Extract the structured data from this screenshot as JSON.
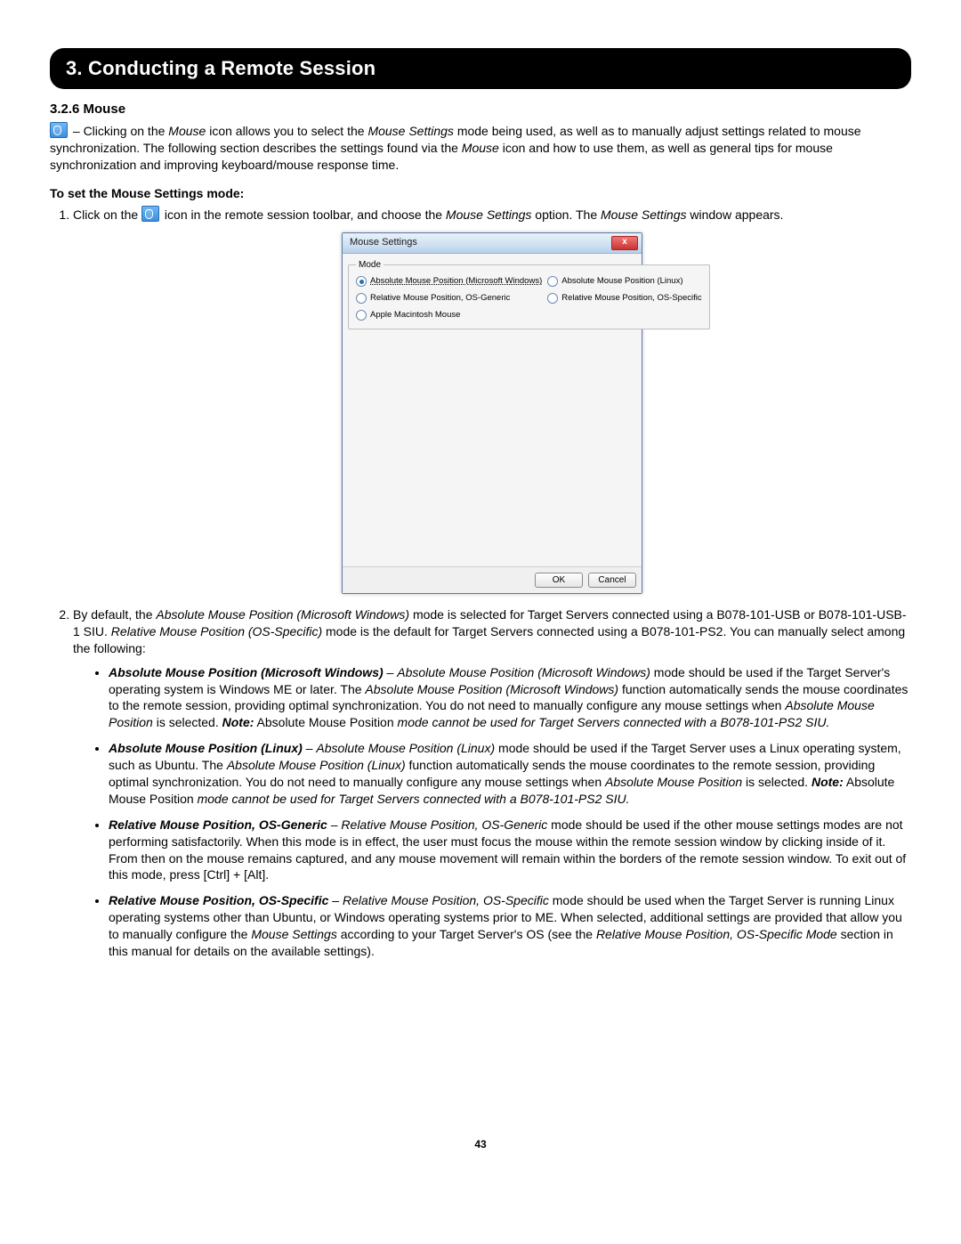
{
  "chapter_title": "3. Conducting a Remote Session",
  "subsection_title": "3.2.6 Mouse",
  "intro_prefix": " – Clicking on the ",
  "intro_em1": "Mouse",
  "intro_mid1": " icon allows you to select the ",
  "intro_em2": "Mouse Settings",
  "intro_mid2": " mode being used, as well as to manually adjust settings related to mouse synchronization. The following section describes the settings found via the ",
  "intro_em3": "Mouse",
  "intro_mid3": " icon and how to use them, as well as general tips for mouse synchronization and improving keyboard/mouse response time.",
  "subhead": "To set the Mouse Settings mode:",
  "step1_a": "Click on the ",
  "step1_b": " icon in the remote session toolbar, and choose the ",
  "step1_em1": "Mouse Settings",
  "step1_c": " option. The ",
  "step1_em2": "Mouse Settings",
  "step1_d": " window appears.",
  "dialog": {
    "title": "Mouse Settings",
    "legend": "Mode",
    "options": {
      "abs_win": "Absolute Mouse Position (Microsoft Windows)",
      "abs_linux": "Absolute Mouse Position (Linux)",
      "rel_generic": "Relative Mouse Position, OS-Generic",
      "rel_specific": "Relative Mouse Position, OS-Specific",
      "apple": "Apple Macintosh Mouse"
    },
    "ok": "OK",
    "cancel": "Cancel",
    "close": "x"
  },
  "step2_a": "By default, the ",
  "step2_em1": "Absolute Mouse Position (Microsoft Windows)",
  "step2_b": " mode is selected for Target Servers connected using a B078-101-USB or B078-101-USB-1 SIU. ",
  "step2_em2": "Relative Mouse Position (OS-Specific)",
  "step2_c": " mode is the default for Target Servers connected using a B078-101-PS2. You can manually select among the following:",
  "b1_title": "Absolute Mouse Position (Microsoft Windows)",
  "b1_a": " – ",
  "b1_em1": "Absolute Mouse Position (Microsoft Windows)",
  "b1_b": " mode should be used if the Target Server's operating system is Windows ME or later. The ",
  "b1_em2": "Absolute Mouse Position (Microsoft Windows)",
  "b1_c": " function automatically sends the mouse coordinates to the remote session, providing optimal synchronization. You do not need to manually configure any mouse settings when ",
  "b1_em3": "Absolute Mouse Position",
  "b1_d": " is selected. ",
  "b1_notelabel": "Note:",
  "b1_note_a": " Absolute Mouse Position ",
  "b1_note_em": "mode cannot be used for Target Servers connected with a B078-101-PS2 SIU.",
  "b2_title": "Absolute Mouse Position (Linux)",
  "b2_a": " – ",
  "b2_em1": "Absolute Mouse Position (Linux)",
  "b2_b": " mode should be used if the Target Server uses a Linux operating system, such as Ubuntu. The ",
  "b2_em2": "Absolute Mouse Position (Linux)",
  "b2_c": " function automatically sends the mouse coordinates to the remote session, providing optimal synchronization. You do not need to manually configure any mouse settings when ",
  "b2_em3": "Absolute Mouse Position",
  "b2_d": " is selected. ",
  "b2_notelabel": "Note:",
  "b2_note_a": " Absolute Mouse Position ",
  "b2_note_em": "mode cannot be used for Target Servers connected with a B078-101-PS2 SIU.",
  "b3_title": "Relative Mouse Position, OS-Generic",
  "b3_a": " – ",
  "b3_em1": "Relative Mouse Position, OS-Generic",
  "b3_b": " mode should be used if the other mouse settings modes are not performing satisfactorily. When this mode is in effect, the user must focus the mouse within the remote session window by clicking inside of it. From then on the mouse remains captured, and any mouse movement will remain within the borders of the remote session window. To exit out of this mode, press [Ctrl] + [Alt].",
  "b4_title": "Relative Mouse Position, OS-Specific",
  "b4_a": " – ",
  "b4_em1": "Relative Mouse Position, OS-Specific",
  "b4_b": " mode should be used when the Target Server is running Linux operating systems other than Ubuntu, or Windows operating systems prior to ME. When selected, additional settings are provided that allow you to manually configure the ",
  "b4_em2": "Mouse Settings",
  "b4_c": " according to your Target Server's OS (see the ",
  "b4_em3": "Relative Mouse Position, OS-Specific Mode",
  "b4_d": " section in this manual for details on the available settings).",
  "page_number": "43"
}
